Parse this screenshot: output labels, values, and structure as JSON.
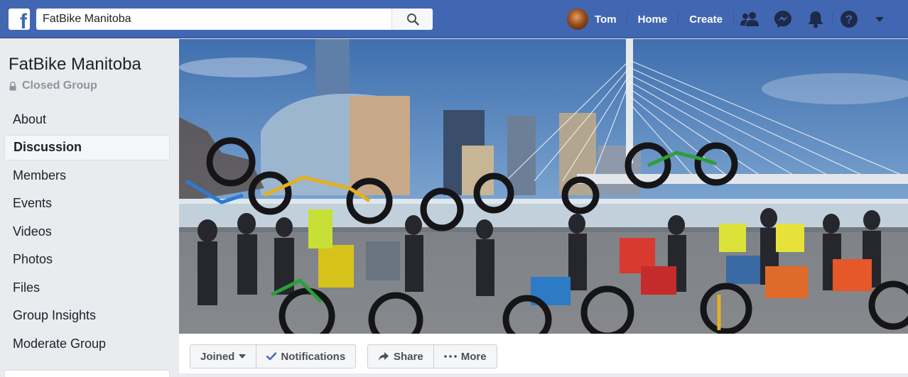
{
  "topbar": {
    "logo_letter": "f",
    "search": {
      "value": "FatBike Manitoba",
      "placeholder": "Search"
    },
    "user_name": "Tom",
    "links": {
      "home": "Home",
      "create": "Create"
    },
    "icons": [
      "friends-icon",
      "messenger-icon",
      "notifications-icon",
      "help-icon",
      "account-menu-caret-icon"
    ]
  },
  "group": {
    "name": "FatBike Manitoba",
    "privacy": "Closed Group"
  },
  "sidebar": {
    "items": [
      {
        "label": "About"
      },
      {
        "label": "Discussion",
        "active": true
      },
      {
        "label": "Members"
      },
      {
        "label": "Events"
      },
      {
        "label": "Videos"
      },
      {
        "label": "Photos"
      },
      {
        "label": "Files"
      },
      {
        "label": "Group Insights"
      },
      {
        "label": "Moderate Group"
      }
    ]
  },
  "actions": {
    "joined": "Joined",
    "notifications": "Notifications",
    "share": "Share",
    "more": "More"
  },
  "colors": {
    "brand_blue": "#4267b2",
    "page_bg": "#e9ebee",
    "text": "#1d2129",
    "muted": "#90949c",
    "check_blue": "#4267b2"
  }
}
